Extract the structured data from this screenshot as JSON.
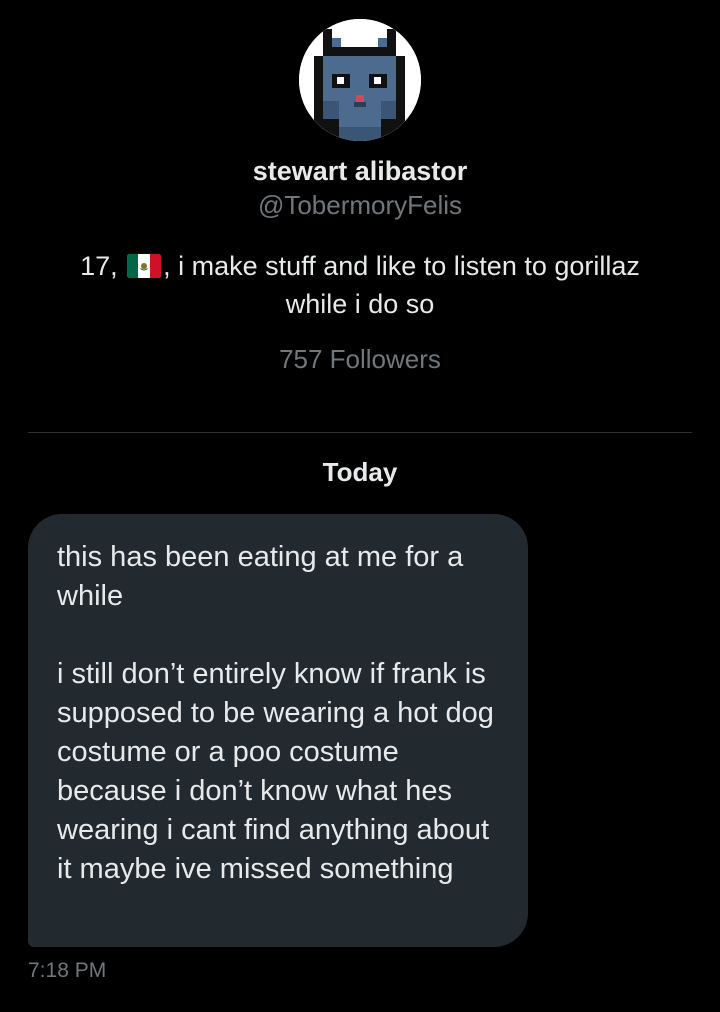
{
  "profile": {
    "display_name": "stewart alibastor",
    "handle": "@TobermoryFelis",
    "bio_before_flag": "17, ",
    "bio_after_flag": ", i make stuff and like to listen to gorillaz while i do so",
    "flag_icon": "mexico-flag-icon",
    "followers": "757 Followers",
    "avatar_icon": "pixel-cat-avatar"
  },
  "conversation": {
    "day_label": "Today",
    "messages": [
      {
        "paragraphs": [
          "this has been eating at me for a while",
          "i still don’t entirely know if frank is supposed to be wearing a hot dog costume or a poo costume because i don’t know what hes wearing i cant find anything about it maybe ive missed something"
        ],
        "time": "7:18 PM"
      }
    ]
  },
  "colors": {
    "background": "#000000",
    "bubble": "#222a30",
    "primary_text": "#e7e9ea",
    "secondary_text": "#71767b",
    "divider": "#2f3336"
  }
}
